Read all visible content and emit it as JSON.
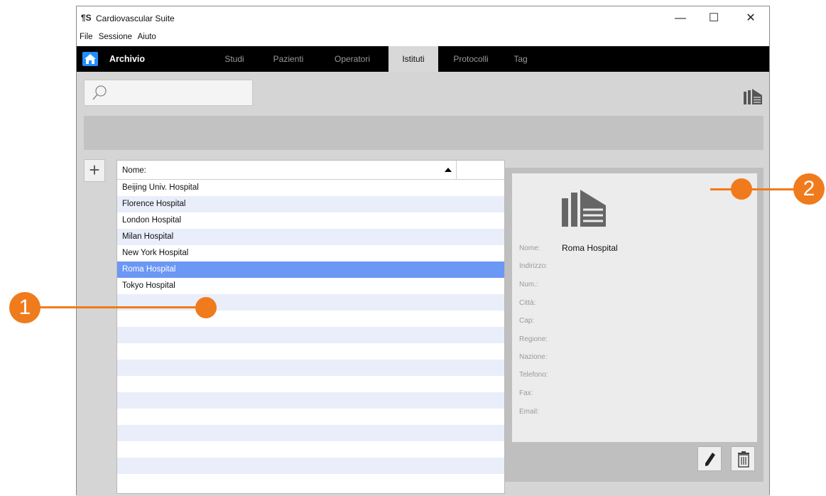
{
  "window": {
    "logo": "¶S",
    "title": "Cardiovascular Suite",
    "minimize": "—",
    "maximize": "☐",
    "close": "✕"
  },
  "menu": [
    "File",
    "Sessione",
    "Aiuto"
  ],
  "nav": {
    "title": "Archivio",
    "tabs": [
      {
        "label": "Studi",
        "active": false
      },
      {
        "label": "Pazienti",
        "active": false
      },
      {
        "label": "Operatori",
        "active": false
      },
      {
        "label": "Istituti",
        "active": true
      },
      {
        "label": "Protocolli",
        "active": false
      },
      {
        "label": "Tag",
        "active": false
      }
    ]
  },
  "search": {
    "placeholder": ""
  },
  "list": {
    "header": "Nome:",
    "sort": "ascending",
    "rows": [
      {
        "name": "Beijing Univ. Hospital",
        "selected": false
      },
      {
        "name": "Florence Hospital",
        "selected": false
      },
      {
        "name": "London Hospital",
        "selected": false
      },
      {
        "name": "Milan Hospital",
        "selected": false
      },
      {
        "name": "New York Hospital",
        "selected": false
      },
      {
        "name": "Roma Hospital",
        "selected": true
      },
      {
        "name": "Tokyo Hospital",
        "selected": false
      }
    ],
    "empty_rows": 12
  },
  "detail": {
    "fields": [
      {
        "label": "Nome:",
        "value": "Roma Hospital"
      },
      {
        "label": "Indirizzo:",
        "value": ""
      },
      {
        "label": "Num.:",
        "value": ""
      },
      {
        "label": "Città:",
        "value": ""
      },
      {
        "label": "Cap:",
        "value": ""
      },
      {
        "label": "Regione:",
        "value": ""
      },
      {
        "label": "Nazione:",
        "value": ""
      },
      {
        "label": "Telefono:",
        "value": ""
      },
      {
        "label": "Fax:",
        "value": ""
      },
      {
        "label": "Email:",
        "value": ""
      }
    ]
  },
  "callouts": [
    "1",
    "2"
  ],
  "colors": {
    "selection": "#6b97f5",
    "stripe": "#e9eefa",
    "callout": "#f07b1c",
    "home": "#1e90ff"
  }
}
